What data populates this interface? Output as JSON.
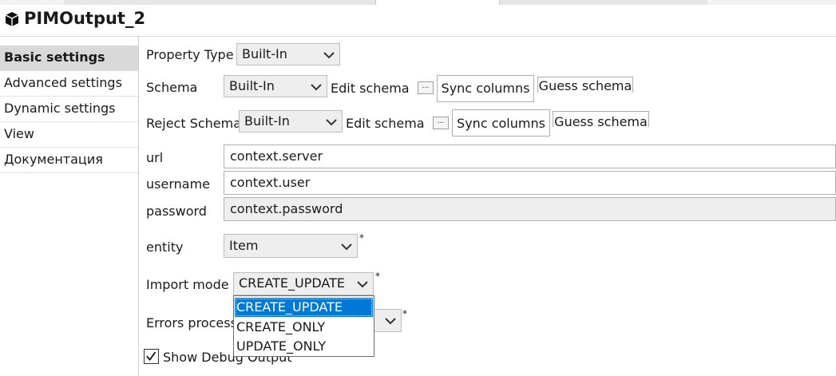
{
  "window": {
    "title": "PIMOutput_2"
  },
  "sidebar": {
    "items": [
      {
        "label": "Basic settings",
        "active": true
      },
      {
        "label": "Advanced settings"
      },
      {
        "label": "Dynamic settings"
      },
      {
        "label": "View"
      },
      {
        "label": "Документация"
      }
    ]
  },
  "form": {
    "property_type": {
      "label": "Property Type",
      "value": "Built-In"
    },
    "schema": {
      "label": "Schema",
      "value": "Built-In",
      "edit_label": "Edit schema",
      "dots": "...",
      "sync": "Sync columns",
      "guess": "Guess schema"
    },
    "reject_schema": {
      "label": "Reject Schema",
      "value": "Built-In",
      "edit_label": "Edit schema",
      "dots": "...",
      "sync": "Sync columns",
      "guess": "Guess schema"
    },
    "url": {
      "label": "url",
      "value": "context.server"
    },
    "username": {
      "label": "username",
      "value": "context.user"
    },
    "password": {
      "label": "password",
      "value": "context.password"
    },
    "entity": {
      "label": "entity",
      "value": "Item",
      "required": "*"
    },
    "import_mode": {
      "label": "Import mode",
      "value": "CREATE_UPDATE",
      "required": "*",
      "options": [
        "CREATE_UPDATE",
        "CREATE_ONLY",
        "UPDATE_ONLY"
      ]
    },
    "errors_processing": {
      "label": "Errors process",
      "required": "*"
    },
    "show_debug": {
      "label": "Show Debug Output",
      "checked": true
    }
  },
  "colors": {
    "selection": "#0078d7",
    "sidebar_active": "#d9d9d9",
    "combo_bg": "#eeeeee"
  }
}
